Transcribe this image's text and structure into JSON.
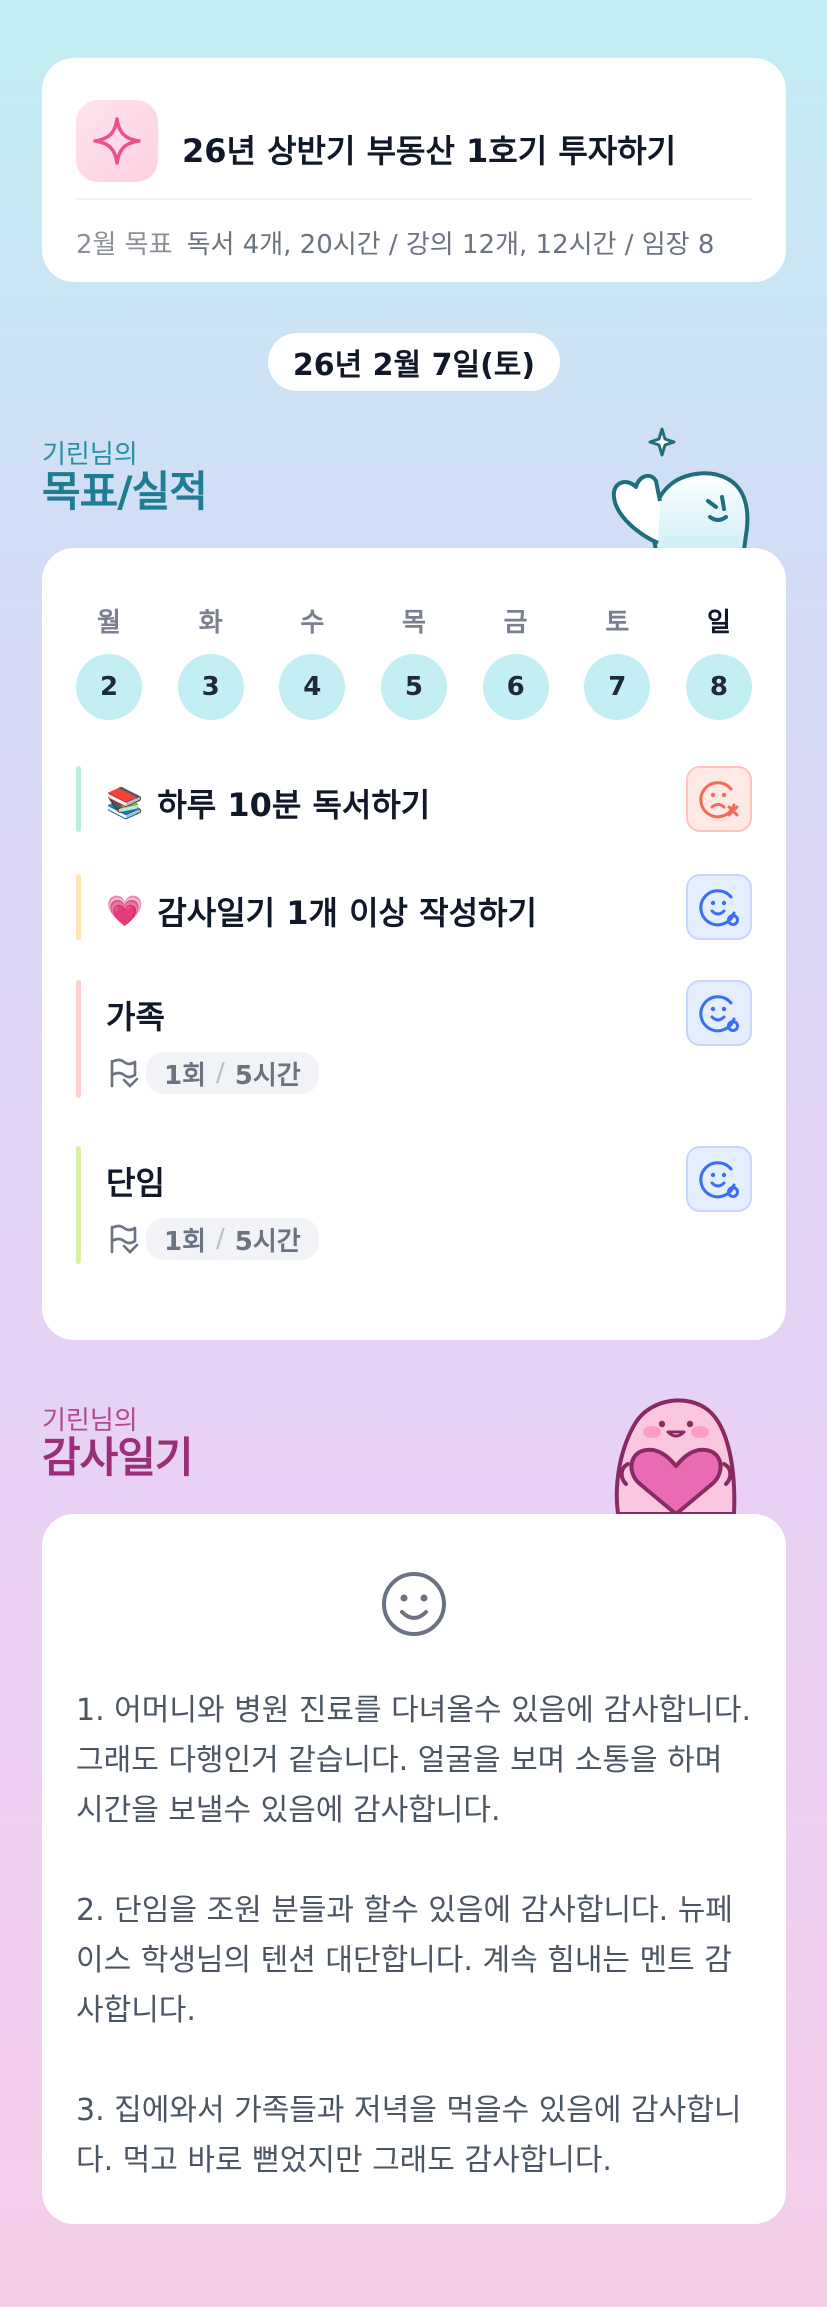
{
  "goal": {
    "title": "26년 상반기 부동산 1호기 투자하기",
    "monthly_label": "2월 목표",
    "monthly_value": "독서 4개, 20시간 / 강의 12개, 12시간 / 임장 8",
    "icon": "sparkle-icon"
  },
  "date": "26년 2월 7일(토)",
  "goals_section": {
    "small": "기린님의",
    "big": "목표/실적"
  },
  "week": {
    "days": [
      {
        "label": "월",
        "num": "2"
      },
      {
        "label": "화",
        "num": "3"
      },
      {
        "label": "수",
        "num": "4"
      },
      {
        "label": "목",
        "num": "5"
      },
      {
        "label": "금",
        "num": "6"
      },
      {
        "label": "토",
        "num": "7"
      },
      {
        "label": "일",
        "num": "8"
      }
    ]
  },
  "tasks": [
    {
      "emoji": "📚",
      "title": "하루 10분 독서하기",
      "status": "fail",
      "bar_color": "#b9efd9"
    },
    {
      "emoji": "💗",
      "title": "감사일기 1개 이상 작성하기",
      "status": "ok",
      "bar_color": "#fde5b6"
    },
    {
      "title": "가족",
      "count": "1회",
      "hours": "5시간",
      "status": "ok",
      "bar_color": "#fbd0cf"
    },
    {
      "title": "단임",
      "count": "1회",
      "hours": "5시간",
      "status": "ok",
      "bar_color": "#d9f0a6"
    }
  ],
  "thanks_section": {
    "small": "기린님의",
    "big": "감사일기"
  },
  "thanks": {
    "entries": [
      "1. 어머니와 병원 진료를 다녀올수 있음에 감사합니다. 그래도 다행인거 같습니다. 얼굴을 보며 소통을 하며 시간을 보낼수 있음에 감사합니다.",
      "2. 단임을 조원 분들과 할수 있음에 감사합니다. 뉴페이스 학생님의 텐션 대단합니다. 계속 힘내는 멘트 감사합니다.",
      "3. 집에와서 가족들과 저녁을 먹을수 있음에 감사합니다. 먹고 바로 뻗었지만 그래도 감사합니다."
    ]
  },
  "colors": {
    "accent_teal": "#1f7d92",
    "accent_magenta": "#9a2e79",
    "day_circle": "#c3eef3",
    "fail": "#f26b5b",
    "ok": "#3b6ff0"
  }
}
